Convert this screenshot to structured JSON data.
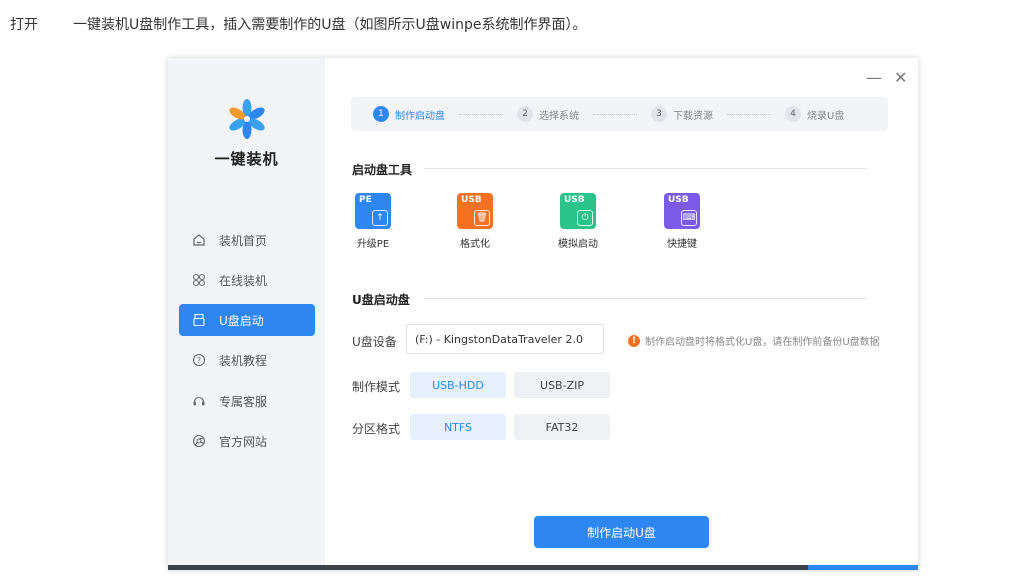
{
  "caption": {
    "lead": "打开",
    "text": "一键装机U盘制作工具，插入需要制作的U盘（如图所示U盘winpe系统制作界面）。"
  },
  "app": {
    "brand": "一键装机",
    "window_controls": {
      "minimize": "—",
      "close": "✕"
    }
  },
  "sidebar": {
    "items": [
      {
        "label": "装机首页",
        "icon": "home-icon",
        "active": false
      },
      {
        "label": "在线装机",
        "icon": "puzzle-icon",
        "active": false
      },
      {
        "label": "U盘启动",
        "icon": "usb-icon",
        "active": true
      },
      {
        "label": "装机教程",
        "icon": "question-icon",
        "active": false
      },
      {
        "label": "专属客服",
        "icon": "headset-icon",
        "active": false
      },
      {
        "label": "官方网站",
        "icon": "browser-icon",
        "active": false
      }
    ]
  },
  "steps": [
    {
      "num": "1",
      "label": "制作启动盘",
      "active": true
    },
    {
      "num": "2",
      "label": "选择系统",
      "active": false
    },
    {
      "num": "3",
      "label": "下载资源",
      "active": false
    },
    {
      "num": "4",
      "label": "烧录U盘",
      "active": false
    }
  ],
  "tools_section": {
    "title": "启动盘工具",
    "tools": [
      {
        "tag": "PE",
        "badge": "↑",
        "label": "升级PE",
        "color": "#2e86f0",
        "icon": "upgrade-pe-icon"
      },
      {
        "tag": "USB",
        "badge": "🗑",
        "label": "格式化",
        "color": "#f27221",
        "icon": "format-icon"
      },
      {
        "tag": "USB",
        "badge": "⏻",
        "label": "模拟启动",
        "color": "#2cc38a",
        "icon": "simulate-boot-icon"
      },
      {
        "tag": "USB",
        "badge": "⌨",
        "label": "快捷键",
        "color": "#7b5be6",
        "icon": "shortcut-icon"
      }
    ]
  },
  "usb_section": {
    "title": "U盘启动盘",
    "device_label": "U盘设备",
    "device_value": "(F:) - KingstonDataTraveler 2.0",
    "warning": "制作启动盘时将格式化U盘，请在制作前备份U盘数据",
    "warning_icon": "!",
    "mode_label": "制作模式",
    "modes": [
      {
        "label": "USB-HDD",
        "selected": true
      },
      {
        "label": "USB-ZIP",
        "selected": false
      }
    ],
    "partition_label": "分区格式",
    "partitions": [
      {
        "label": "NTFS",
        "selected": true
      },
      {
        "label": "FAT32",
        "selected": false
      }
    ]
  },
  "make_button": "制作启动U盘",
  "colors": {
    "accent": "#2e86f0",
    "warning": "#f27221",
    "sidebar_bg": "#f2f4f7"
  }
}
